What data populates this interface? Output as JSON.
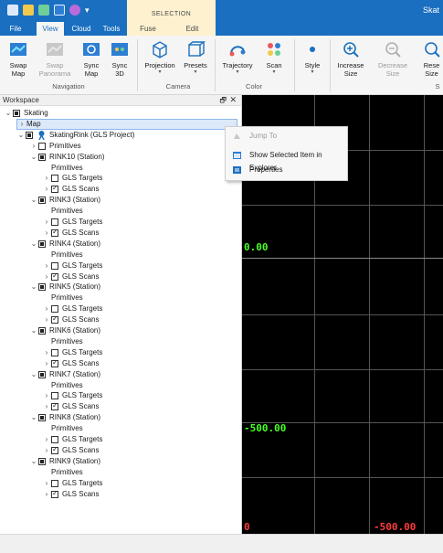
{
  "titlebar": {
    "app_title": "Skat",
    "quick_access": [
      "save-icon",
      "open-icon",
      "tool-icon",
      "layout-icon",
      "flower-icon",
      "customize-icon"
    ],
    "customize_glyph": "▾"
  },
  "contextual": {
    "header": "SELECTION"
  },
  "tabs": [
    {
      "label": "File"
    },
    {
      "label": "View"
    },
    {
      "label": "Cloud"
    },
    {
      "label": "Tools"
    },
    {
      "label": "Fuse"
    },
    {
      "label": "Edit"
    }
  ],
  "ribbon": {
    "navigation": {
      "label": "Navigation",
      "buttons": [
        {
          "label1": "Swap",
          "label2": "Map"
        },
        {
          "label1": "Swap",
          "label2": "Panorama"
        },
        {
          "label1": "Sync",
          "label2": "Map"
        },
        {
          "label1": "Sync",
          "label2": "3D"
        }
      ]
    },
    "camera": {
      "label": "Camera",
      "buttons": [
        {
          "label": "Projection"
        },
        {
          "label": "Presets"
        }
      ]
    },
    "color": {
      "label": "Color",
      "buttons": [
        {
          "label": "Trajectory"
        },
        {
          "label": "Scan"
        }
      ]
    },
    "style": {
      "label": "Style"
    },
    "size": {
      "buttons": [
        {
          "label1": "Increase",
          "label2": "Size"
        },
        {
          "label1": "Decrease",
          "label2": "Size"
        },
        {
          "label1": "Rese",
          "label2": "Size"
        }
      ],
      "label": "S"
    },
    "dropdown_glyph": "▾"
  },
  "workspace": {
    "title": "Workspace",
    "pin_glyph": "🗗",
    "close_glyph": "✕",
    "root": "Skating",
    "map": "Map",
    "project": "SkatingRink (GLS Project)",
    "primitives": "Primitives",
    "gls_targets": "GLS Targets",
    "gls_scans": "GLS Scans",
    "stations": [
      "RINK10 (Station)",
      "RINK3 (Station)",
      "RINK4 (Station)",
      "RINK5 (Station)",
      "RINK6 (Station)",
      "RINK7 (Station)",
      "RINK8 (Station)",
      "RINK9 (Station)"
    ],
    "expand_glyph": "›",
    "collapse_glyph": "⌄"
  },
  "viewport": {
    "labels": [
      {
        "text": "0.00",
        "color": "green"
      },
      {
        "text": "-500.00",
        "color": "green"
      },
      {
        "text": "0",
        "color": "red"
      },
      {
        "text": "-500.00",
        "color": "red"
      }
    ]
  },
  "context_menu": {
    "items": [
      {
        "label": "Jump To",
        "enabled": false,
        "icon": "jump-icon"
      },
      {
        "label": "Show Selected Item in Explorer",
        "enabled": true,
        "icon": "explorer-icon"
      },
      {
        "label": "Properties",
        "enabled": true,
        "icon": "properties-icon"
      }
    ]
  },
  "colors": {
    "accent": "#1a6fc0",
    "contextual": "#fdf1cf",
    "viewport_bg": "#000000",
    "axis_green": "#4aff2a",
    "axis_red": "#ff3b3b"
  }
}
